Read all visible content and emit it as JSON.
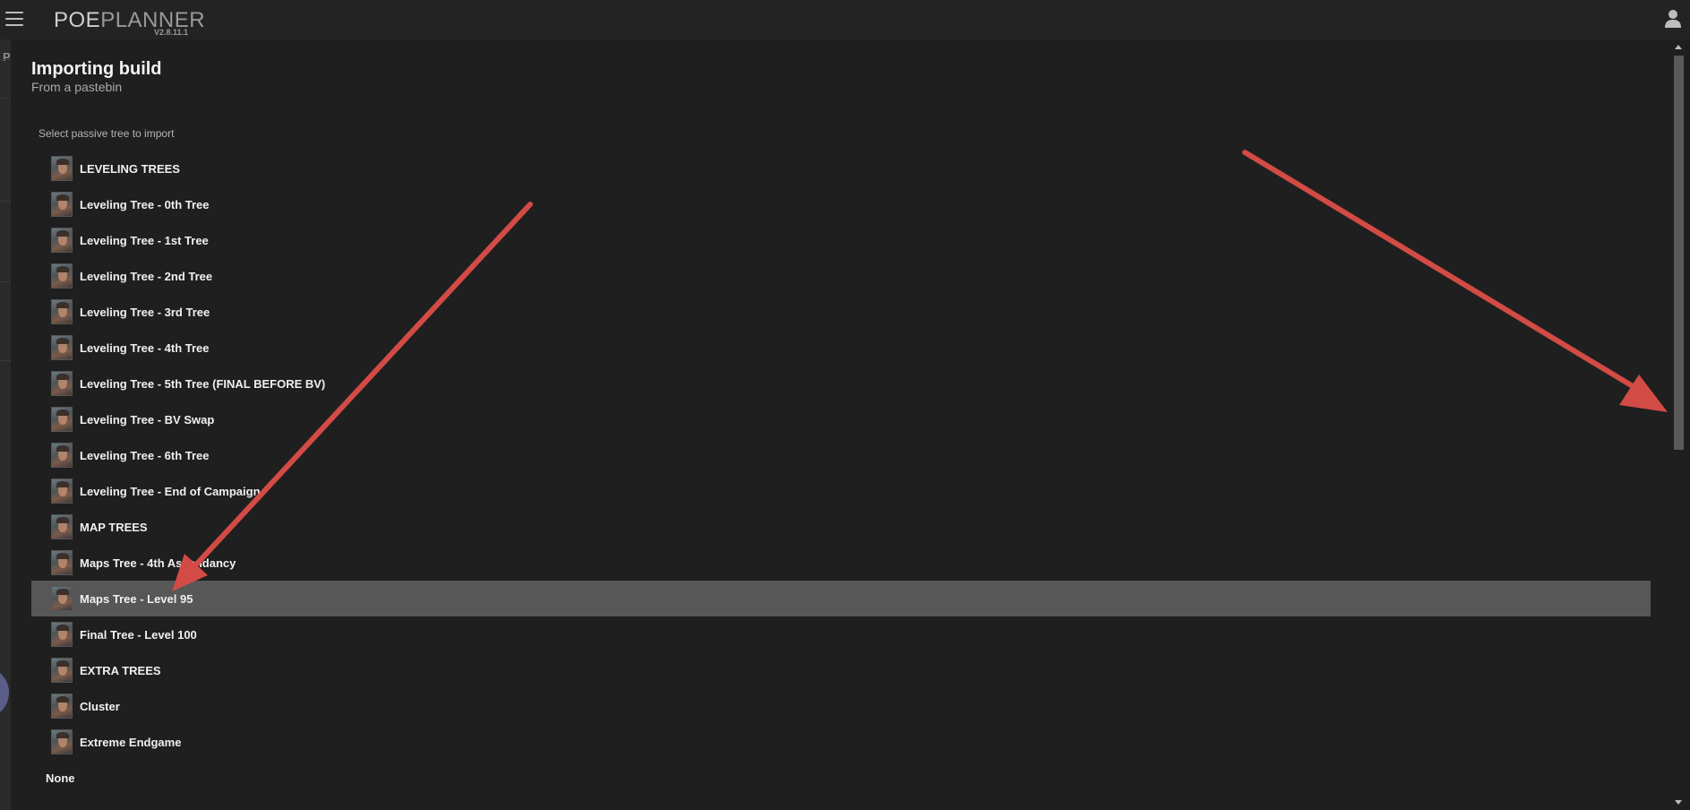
{
  "app": {
    "logo_bold": "POE",
    "logo_light": "PLANNER",
    "version": "V2.8.11.1"
  },
  "leftstrip": {
    "letter": "P"
  },
  "dialog": {
    "title": "Importing build",
    "subtitle": "From a pastebin",
    "select_label": "Select passive tree to import",
    "items": [
      {
        "label": "LEVELING TREES",
        "selected": false
      },
      {
        "label": "Leveling Tree - 0th Tree",
        "selected": false
      },
      {
        "label": "Leveling Tree - 1st Tree",
        "selected": false
      },
      {
        "label": "Leveling Tree - 2nd Tree",
        "selected": false
      },
      {
        "label": "Leveling Tree - 3rd Tree",
        "selected": false
      },
      {
        "label": "Leveling Tree - 4th Tree",
        "selected": false
      },
      {
        "label": "Leveling Tree - 5th Tree (FINAL BEFORE BV)",
        "selected": false
      },
      {
        "label": "Leveling Tree - BV Swap",
        "selected": false
      },
      {
        "label": "Leveling Tree - 6th Tree",
        "selected": false
      },
      {
        "label": "Leveling Tree - End of Campaign",
        "selected": false
      },
      {
        "label": "MAP TREES",
        "selected": false
      },
      {
        "label": "Maps Tree - 4th Ascendancy",
        "selected": false
      },
      {
        "label": "Maps Tree - Level 95",
        "selected": true
      },
      {
        "label": "Final Tree - Level 100",
        "selected": false
      },
      {
        "label": "EXTRA TREES",
        "selected": false
      },
      {
        "label": "Cluster",
        "selected": false
      },
      {
        "label": "Extreme Endgame",
        "selected": false
      }
    ],
    "none_label": "None"
  },
  "colors": {
    "background": "#1e1e1f",
    "selected_row": "#575757",
    "annotation_arrow": "#d24b45"
  },
  "icons": {
    "menu": "hamburger-icon",
    "user": "user-icon",
    "item_avatar": "character-portrait-icon"
  }
}
